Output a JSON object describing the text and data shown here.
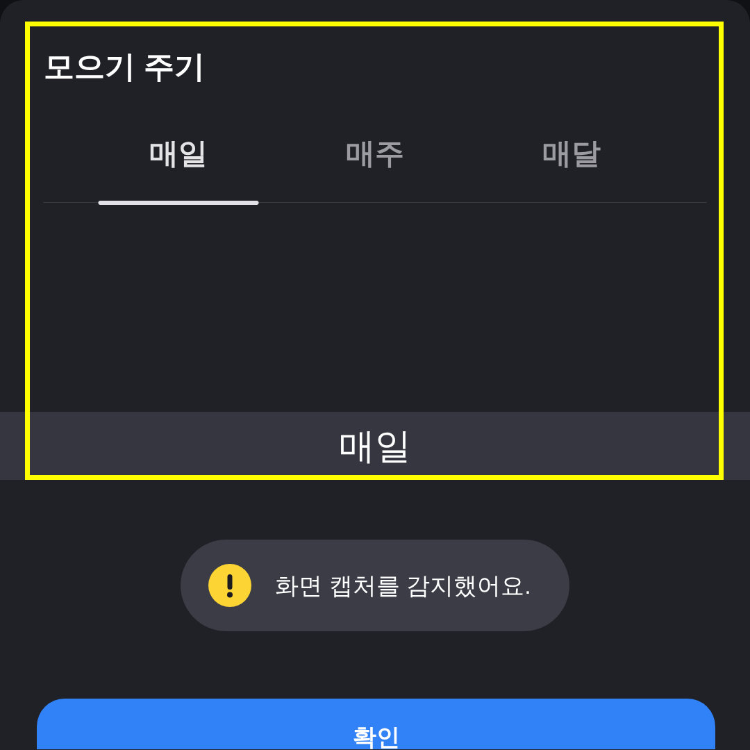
{
  "sheet": {
    "title": "모으기 주기"
  },
  "tabs": [
    {
      "label": "매일",
      "selected": true
    },
    {
      "label": "매주",
      "selected": false
    },
    {
      "label": "매달",
      "selected": false
    }
  ],
  "picker": {
    "options": [
      {
        "label": "매일",
        "selected": true
      }
    ]
  },
  "toast": {
    "message": "화면 캡처를 감지했어요."
  },
  "button": {
    "label": "확인"
  },
  "highlight_frame": true
}
